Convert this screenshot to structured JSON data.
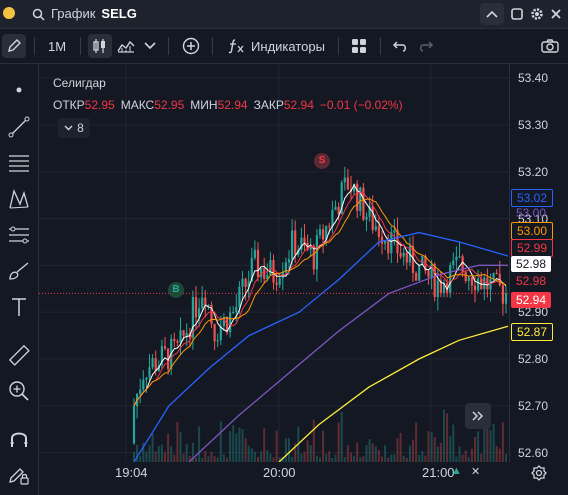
{
  "window": {
    "title_prefix": "График",
    "title_symbol": "SELG"
  },
  "toolbar": {
    "interval": "1M",
    "indicators_label": "Индикаторы"
  },
  "legend": {
    "name": "Селигдар",
    "open_label": "ОТКР",
    "open_value": "52.95",
    "high_label": "МАКС",
    "high_value": "52.95",
    "low_label": "МИН",
    "low_value": "52.94",
    "close_label": "ЗАКР",
    "close_value": "52.94",
    "change": "−0.01 (−0.02%)",
    "indicators_count": "8"
  },
  "markers": {
    "sell": "S",
    "buy": "B"
  },
  "chart_data": {
    "type": "candlestick",
    "y_ticks": [
      "53.40",
      "53.30",
      "53.20",
      "53.10",
      "52.90",
      "52.80",
      "52.70",
      "52.60"
    ],
    "x_ticks": [
      "19:04",
      "20:00",
      "21:00"
    ],
    "price_labels": [
      {
        "value": "53.02",
        "color": "#2962ff",
        "style": "outline"
      },
      {
        "value": "53.00",
        "color": "#7e57c2",
        "style": "text"
      },
      {
        "value": "53.00",
        "color": "#ff9800",
        "style": "outline"
      },
      {
        "value": "52.99",
        "color": "#f23645",
        "style": "outline"
      },
      {
        "value": "52.98",
        "color": "#ffffff",
        "style": "white"
      },
      {
        "value": "52.98",
        "color": "#f23645",
        "style": "text"
      },
      {
        "value": "52.94",
        "color": "#f23645",
        "style": "filled"
      },
      {
        "value": "52.87",
        "color": "#ffeb3b",
        "style": "outline"
      }
    ],
    "last_price": "52.94",
    "ylim": [
      52.58,
      53.43
    ],
    "series": [
      {
        "name": "close",
        "values": [
          52.62,
          52.68,
          52.74,
          52.8,
          52.78,
          52.88,
          52.92,
          52.94,
          52.91,
          52.99,
          53.04,
          53.01,
          53.08,
          53.18,
          53.15,
          53.1,
          53.05,
          53.02,
          52.99,
          52.97,
          52.98,
          52.96,
          52.95,
          52.94
        ]
      }
    ]
  }
}
